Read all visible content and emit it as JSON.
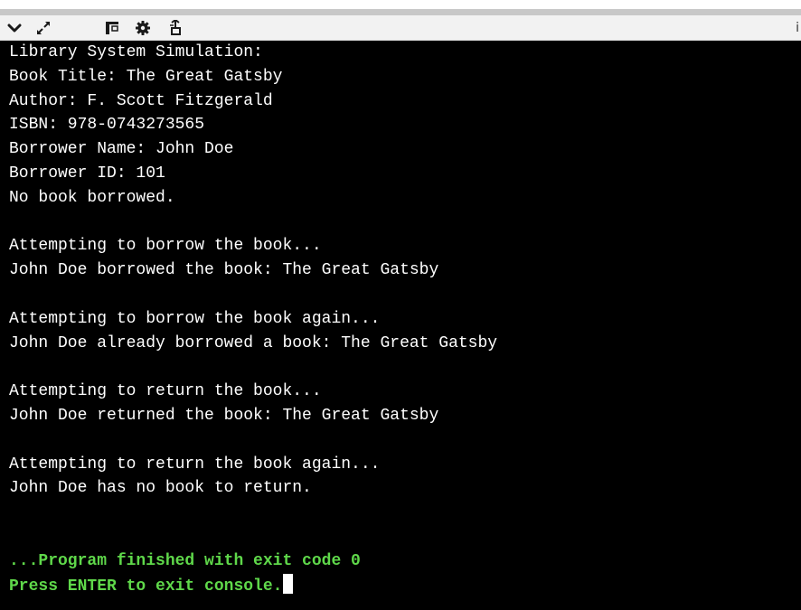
{
  "toolbar": {
    "icons": [
      {
        "name": "chevron-down-icon"
      },
      {
        "name": "expand-icon"
      },
      {
        "name": "panel-icon"
      },
      {
        "name": "gear-icon"
      },
      {
        "name": "share-icon"
      }
    ],
    "right_text": "i"
  },
  "console": {
    "lines": [
      "Library System Simulation:",
      "Book Title: The Great Gatsby",
      "Author: F. Scott Fitzgerald",
      "ISBN: 978-0743273565",
      "Borrower Name: John Doe",
      "Borrower ID: 101",
      "No book borrowed.",
      "",
      "Attempting to borrow the book...",
      "John Doe borrowed the book: The Great Gatsby",
      "",
      "Attempting to borrow the book again...",
      "John Doe already borrowed a book: The Great Gatsby",
      "",
      "Attempting to return the book...",
      "John Doe returned the book: The Great Gatsby",
      "",
      "Attempting to return the book again...",
      "John Doe has no book to return.",
      "",
      ""
    ],
    "finish_line": "...Program finished with exit code 0",
    "prompt_line": "Press ENTER to exit console.",
    "text_color": "#ffffff",
    "status_color": "#5fd84a",
    "background": "#000000"
  }
}
